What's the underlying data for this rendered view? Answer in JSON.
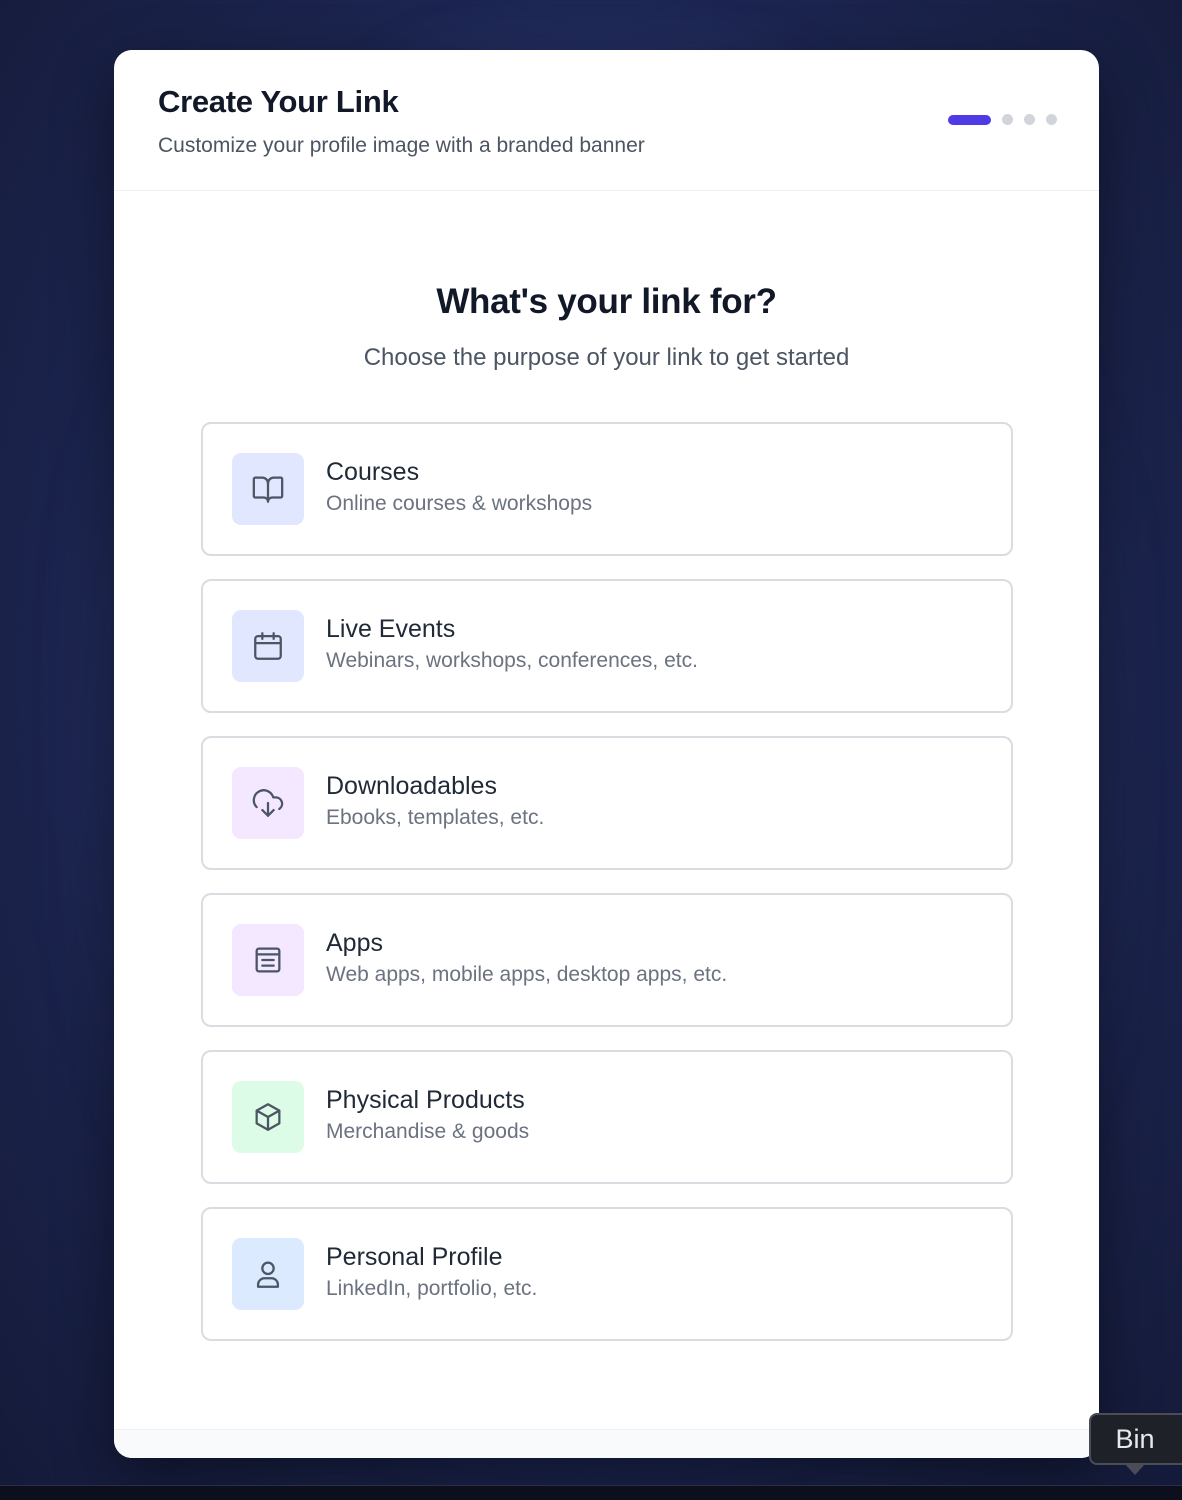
{
  "header": {
    "title": "Create Your Link",
    "subtitle": "Customize your profile image with a branded banner",
    "steps": {
      "current": 1,
      "total": 4
    }
  },
  "main": {
    "question": "What's your link for?",
    "question_sub": "Choose the purpose of your link to get started",
    "options": [
      {
        "title": "Courses",
        "description": "Online courses & workshops",
        "icon": "book-icon",
        "icon_bg": "#e0e7ff"
      },
      {
        "title": "Live Events",
        "description": "Webinars, workshops, conferences, etc.",
        "icon": "calendar-icon",
        "icon_bg": "#e0e7ff"
      },
      {
        "title": "Downloadables",
        "description": "Ebooks, templates, etc.",
        "icon": "cloud-download-icon",
        "icon_bg": "#f3e8ff"
      },
      {
        "title": "Apps",
        "description": "Web apps, mobile apps, desktop apps, etc.",
        "icon": "app-window-icon",
        "icon_bg": "#f3e8ff"
      },
      {
        "title": "Physical Products",
        "description": "Merchandise & goods",
        "icon": "package-box-icon",
        "icon_bg": "#dcfce7"
      },
      {
        "title": "Personal Profile",
        "description": "LinkedIn, portfolio, etc.",
        "icon": "user-icon",
        "icon_bg": "#dbeafe"
      }
    ]
  },
  "colors": {
    "accent": "#4f3ae6",
    "icon_stroke": "#4b5563"
  },
  "tooltip": {
    "label": "Bin"
  }
}
